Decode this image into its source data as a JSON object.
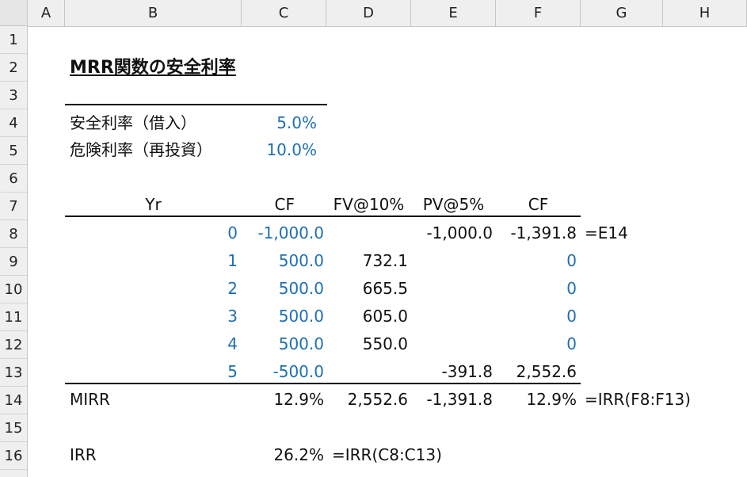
{
  "columns": [
    "A",
    "B",
    "C",
    "D",
    "E",
    "F",
    "G",
    "H"
  ],
  "rows": [
    "1",
    "2",
    "3",
    "4",
    "5",
    "6",
    "7",
    "8",
    "9",
    "10",
    "11",
    "12",
    "13",
    "14",
    "15",
    "16"
  ],
  "title": "MRR関数の安全利率",
  "rates": {
    "safe_label": "安全利率（借入）",
    "safe_value": "5.0%",
    "risk_label": "危険利率（再投資）",
    "risk_value": "10.0%"
  },
  "headers": {
    "yr": "Yr",
    "cf": "CF",
    "fv": "FV@10%",
    "pv": "PV@5%",
    "cf2": "CF"
  },
  "table": [
    {
      "yr": "0",
      "cf": "-1,000.0",
      "fv": "",
      "pv": "-1,000.0",
      "cf2": "-1,391.8",
      "note": "=E14"
    },
    {
      "yr": "1",
      "cf": "500.0",
      "fv": "732.1",
      "pv": "",
      "cf2": "0",
      "note": ""
    },
    {
      "yr": "2",
      "cf": "500.0",
      "fv": "665.5",
      "pv": "",
      "cf2": "0",
      "note": ""
    },
    {
      "yr": "3",
      "cf": "500.0",
      "fv": "605.0",
      "pv": "",
      "cf2": "0",
      "note": ""
    },
    {
      "yr": "4",
      "cf": "500.0",
      "fv": "550.0",
      "pv": "",
      "cf2": "0",
      "note": ""
    },
    {
      "yr": "5",
      "cf": "-500.0",
      "fv": "",
      "pv": "-391.8",
      "cf2": "2,552.6",
      "note": ""
    }
  ],
  "mirr": {
    "label": "MIRR",
    "c": "12.9%",
    "d": "2,552.6",
    "e": "-1,391.8",
    "f": "12.9%",
    "formula": "=IRR(F8:F13)"
  },
  "irr": {
    "label": "IRR",
    "c": "26.2%",
    "formula": "=IRR(C8:C13)"
  }
}
